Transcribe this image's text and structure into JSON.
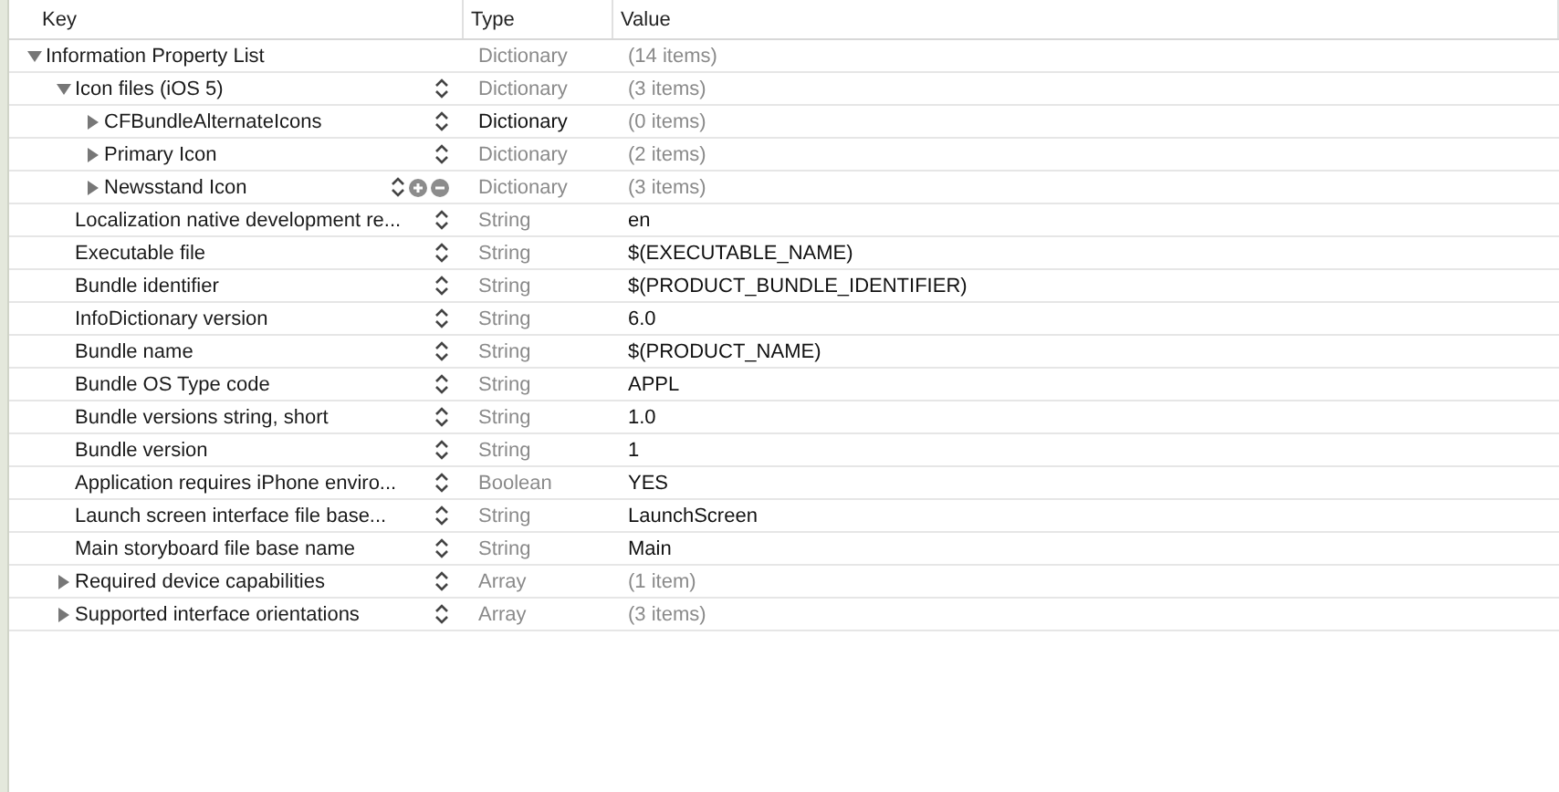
{
  "columns": [
    "Key",
    "Type",
    "Value"
  ],
  "rows": [
    {
      "key": "Information Property List",
      "type": "Dictionary",
      "value": "(14 items)",
      "type_muted": true,
      "value_muted": true,
      "stepper": false,
      "expanded": true,
      "children": [
        {
          "key": "Icon files (iOS 5)",
          "type": "Dictionary",
          "value": "(3 items)",
          "type_muted": true,
          "value_muted": true,
          "stepper": true,
          "expanded": true,
          "children": [
            {
              "key": "CFBundleAlternateIcons",
              "type": "Dictionary",
              "value": "(0 items)",
              "type_muted": false,
              "value_muted": true,
              "stepper": true,
              "expanded": false
            },
            {
              "key": "Primary Icon",
              "type": "Dictionary",
              "value": "(2 items)",
              "type_muted": true,
              "value_muted": true,
              "stepper": true,
              "expanded": false
            },
            {
              "key": "Newsstand Icon",
              "type": "Dictionary",
              "value": "(3 items)",
              "type_muted": true,
              "value_muted": true,
              "stepper": true,
              "expanded": false,
              "hovered": true
            }
          ]
        },
        {
          "key": "Localization native development re...",
          "type": "String",
          "value": "en",
          "type_muted": true,
          "value_muted": false,
          "stepper": true
        },
        {
          "key": "Executable file",
          "type": "String",
          "value": "$(EXECUTABLE_NAME)",
          "type_muted": true,
          "value_muted": false,
          "stepper": true
        },
        {
          "key": "Bundle identifier",
          "type": "String",
          "value": "$(PRODUCT_BUNDLE_IDENTIFIER)",
          "type_muted": true,
          "value_muted": false,
          "stepper": true
        },
        {
          "key": "InfoDictionary version",
          "type": "String",
          "value": "6.0",
          "type_muted": true,
          "value_muted": false,
          "stepper": true
        },
        {
          "key": "Bundle name",
          "type": "String",
          "value": "$(PRODUCT_NAME)",
          "type_muted": true,
          "value_muted": false,
          "stepper": true
        },
        {
          "key": "Bundle OS Type code",
          "type": "String",
          "value": "APPL",
          "type_muted": true,
          "value_muted": false,
          "stepper": true
        },
        {
          "key": "Bundle versions string, short",
          "type": "String",
          "value": "1.0",
          "type_muted": true,
          "value_muted": false,
          "stepper": true
        },
        {
          "key": "Bundle version",
          "type": "String",
          "value": "1",
          "type_muted": true,
          "value_muted": false,
          "stepper": true
        },
        {
          "key": "Application requires iPhone enviro...",
          "type": "Boolean",
          "value": "YES",
          "type_muted": true,
          "value_muted": false,
          "stepper": true
        },
        {
          "key": "Launch screen interface file base...",
          "type": "String",
          "value": "LaunchScreen",
          "type_muted": true,
          "value_muted": false,
          "stepper": true
        },
        {
          "key": "Main storyboard file base name",
          "type": "String",
          "value": "Main",
          "type_muted": true,
          "value_muted": false,
          "stepper": true
        },
        {
          "key": "Required device capabilities",
          "type": "Array",
          "value": "(1 item)",
          "type_muted": true,
          "value_muted": true,
          "stepper": true,
          "expanded": false
        },
        {
          "key": "Supported interface orientations",
          "type": "Array",
          "value": "(3 items)",
          "type_muted": true,
          "value_muted": true,
          "stepper": true,
          "expanded": false
        }
      ]
    }
  ]
}
